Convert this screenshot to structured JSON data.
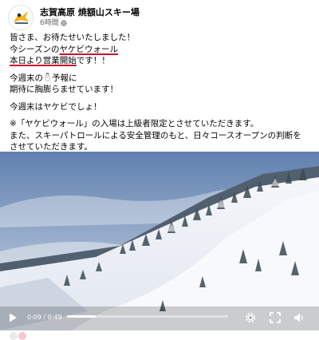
{
  "page": {
    "name": "志賀高原 焼額山スキー場",
    "time": "6時間",
    "globe_icon": "globe-icon"
  },
  "post": {
    "line1": "皆さま、お待たせいたしました！",
    "line2_pre": "今シーズンの",
    "line2_ul": "ヤケビウォール",
    "line3_ul": "本日より営業開始",
    "line3_post": "です！！",
    "line4_pre": "今週末の",
    "line4_post": "予報に",
    "line5": "期待に胸膨らませています！",
    "line6": "今週末はヤケビでしょ！",
    "line7": "※「ヤケビウォール」の入場は上級者限定とさせていただきます。",
    "line8": "また、スキーパトロールによる安全管理のもと、日々コースオープンの判断を",
    "line9": "させていただきます。",
    "snowman_icon": "snowman-icon"
  },
  "video": {
    "current_time": "0:09",
    "duration": "0:49",
    "time_label": "0:09 / 0:49",
    "progress": 0.18,
    "icons": [
      "play-icon",
      "settings-gear-icon",
      "fullscreen-icon",
      "volume-icon"
    ]
  },
  "colors": {
    "underline": "#c8102e",
    "sky": "#6d8cb8",
    "muted_text": "#65676b"
  }
}
